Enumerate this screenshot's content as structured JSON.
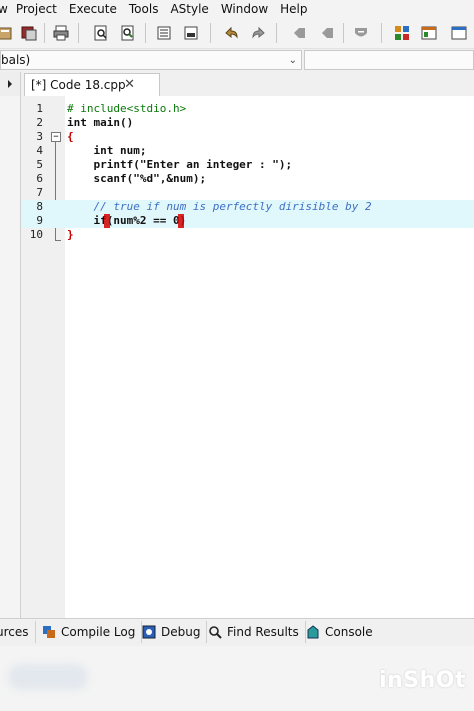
{
  "menu": [
    "w",
    "Project",
    "Execute",
    "Tools",
    "AStyle",
    "Window",
    "Help"
  ],
  "toolbar": {
    "icons": [
      "new-project-icon",
      "save-all-icon",
      "print-icon",
      "find-icon",
      "replace-icon",
      "indent-icon",
      "comment-icon",
      "undo-icon",
      "redo-icon",
      "bookmark-prev-icon",
      "bookmark-next-icon",
      "insert-icon",
      "grid-icon",
      "window-icon",
      "fullscreen-icon"
    ]
  },
  "scope": {
    "value": "bals)"
  },
  "editor_tab": {
    "label": "[*] Code 18.cpp",
    "close": "✕"
  },
  "code": {
    "lines": [
      {
        "num": "1",
        "text": "# include<stdio.h>"
      },
      {
        "num": "2",
        "text": "int main()"
      },
      {
        "num": "3",
        "text": "{"
      },
      {
        "num": "4",
        "text": "    int num;"
      },
      {
        "num": "5",
        "text": "    printf(\"Enter an integer : \");"
      },
      {
        "num": "6",
        "text": "    scanf(\"%d\",&num);"
      },
      {
        "num": "7",
        "text": ""
      },
      {
        "num": "8",
        "text": "    // true if num is perfectly dirisible by 2"
      },
      {
        "num": "9",
        "text": "    if(num%2 == 0)"
      },
      {
        "num": "10",
        "text": "}"
      }
    ]
  },
  "bottom_tabs": [
    "urces",
    "Compile Log",
    "Debug",
    "Find Results",
    "Console"
  ],
  "watermark": "inShOt",
  "colors": {
    "current_line": "#e0f7fb",
    "brace_match": "#d40000",
    "comment": "#3f6fc4"
  }
}
